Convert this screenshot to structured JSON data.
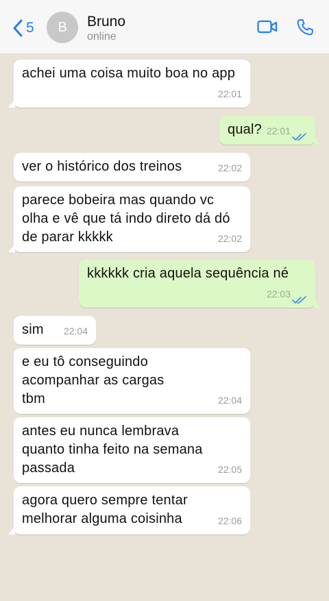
{
  "header": {
    "back_count": "5",
    "avatar_initial": "B",
    "contact_name": "Bruno",
    "contact_status": "online"
  },
  "colors": {
    "accent": "#1f7ef5",
    "outgoing_bubble": "#dcf8c6",
    "incoming_bubble": "#ffffff",
    "read_ticks": "#3b8ee8"
  },
  "messages": [
    {
      "dir": "in",
      "text": "achei uma coisa muito boa no app",
      "time": "22:01"
    },
    {
      "dir": "out",
      "text": "qual?",
      "time": "22:01"
    },
    {
      "dir": "in",
      "text": "ver o histórico dos treinos",
      "time": "22:02"
    },
    {
      "dir": "in",
      "text": "parece bobeira mas quando vc olha e vê que tá indo direto dá dó de parar kkkkk",
      "time": "22:02"
    },
    {
      "dir": "out",
      "text": "kkkkkk cria aquela sequência né",
      "time": "22:03"
    },
    {
      "dir": "in",
      "text": "sim",
      "time": "22:04"
    },
    {
      "dir": "in",
      "text": "e eu tô conseguindo acompanhar as cargas tbm",
      "time": "22:04"
    },
    {
      "dir": "in",
      "text": "antes eu nunca lembrava quanto tinha feito na semana passada",
      "time": "22:05"
    },
    {
      "dir": "in",
      "text": "agora quero sempre tentar melhorar alguma coisinha",
      "time": "22:06"
    }
  ]
}
